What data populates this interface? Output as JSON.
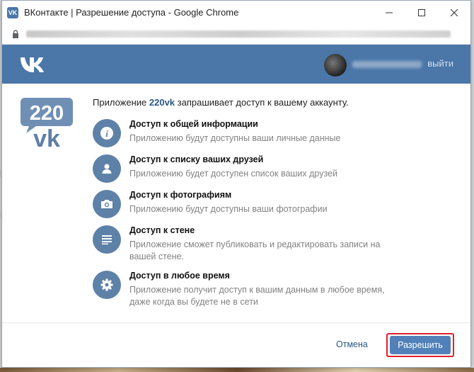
{
  "window": {
    "title": "ВКонтакте | Разрешение доступа - Google Chrome",
    "controls": [
      "minimize",
      "maximize",
      "close"
    ]
  },
  "header": {
    "logout": "выйти"
  },
  "intro": {
    "prefix": "Приложение ",
    "app_name": "220vk",
    "suffix": " запрашивает доступ к вашему аккаунту."
  },
  "app_logo": {
    "line1": "220",
    "line2": "vk"
  },
  "permissions": [
    {
      "icon": "info-icon",
      "title": "Доступ к общей информации",
      "desc": "Приложению будут доступны ваши личные данные"
    },
    {
      "icon": "person-icon",
      "title": "Доступ к списку ваших друзей",
      "desc": "Приложению будет доступен список ваших друзей"
    },
    {
      "icon": "camera-icon",
      "title": "Доступ к фотографиям",
      "desc": "Приложению будут доступны ваши фотографии"
    },
    {
      "icon": "wall-icon",
      "title": "Доступ к стене",
      "desc": "Приложение сможет публиковать и редактировать записи на вашей стене."
    },
    {
      "icon": "gear-icon",
      "title": "Доступ в любое время",
      "desc": "Приложение получит доступ к вашим данным в любое время, даже когда вы будете не в сети"
    }
  ],
  "footer": {
    "cancel": "Отмена",
    "allow": "Разрешить"
  },
  "colors": {
    "vk_blue": "#4a76a8",
    "button_blue": "#5181b8",
    "icon_blue": "#5e81a8",
    "highlight_red": "#e0202a"
  }
}
